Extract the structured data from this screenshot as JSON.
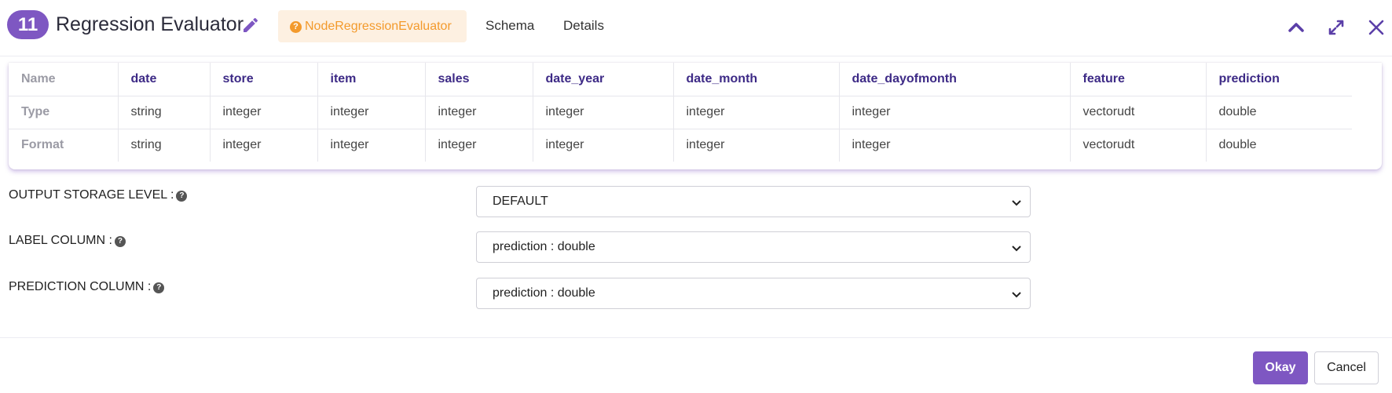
{
  "header": {
    "node_number": "11",
    "title": "Regression Evaluator",
    "node_type": "NodeRegressionEvaluator",
    "tabs": [
      "Schema",
      "Details"
    ],
    "icons": [
      "pencil-icon",
      "chevron-up-icon",
      "expand-icon",
      "close-icon"
    ]
  },
  "schema": {
    "row_headers": [
      "Name",
      "Type",
      "Format"
    ],
    "columns": [
      {
        "name": "date",
        "type": "string",
        "format": "string"
      },
      {
        "name": "store",
        "type": "integer",
        "format": "integer"
      },
      {
        "name": "item",
        "type": "integer",
        "format": "integer"
      },
      {
        "name": "sales",
        "type": "integer",
        "format": "integer"
      },
      {
        "name": "date_year",
        "type": "integer",
        "format": "integer"
      },
      {
        "name": "date_month",
        "type": "integer",
        "format": "integer"
      },
      {
        "name": "date_dayofmonth",
        "type": "integer",
        "format": "integer"
      },
      {
        "name": "feature",
        "type": "vectorudt",
        "format": "vectorudt"
      },
      {
        "name": "prediction",
        "type": "double",
        "format": "double"
      }
    ]
  },
  "form": {
    "output_storage_level": {
      "label": "OUTPUT STORAGE LEVEL :",
      "value": "DEFAULT"
    },
    "label_column": {
      "label": "LABEL COLUMN :",
      "value": "prediction : double"
    },
    "prediction_column": {
      "label": "PREDICTION COLUMN :",
      "value": "prediction : double"
    }
  },
  "footer": {
    "okay_label": "Okay",
    "cancel_label": "Cancel"
  },
  "colors": {
    "accent": "#7e57c2",
    "header_text": "#3d2a86",
    "badge_bg": "#fdf0e1",
    "badge_text": "#f39a2c"
  }
}
